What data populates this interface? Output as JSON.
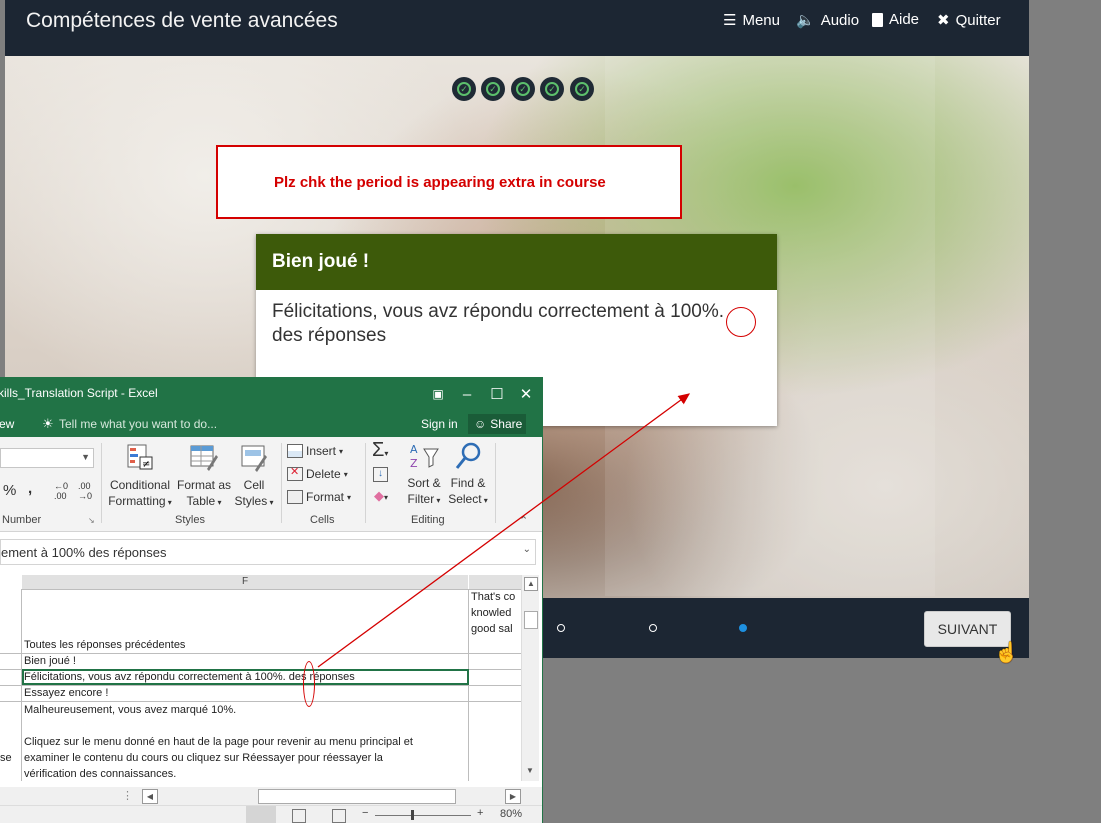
{
  "course": {
    "title": "Compétences de vente avancées",
    "nav": [
      {
        "label": "Menu",
        "icon": "list-icon"
      },
      {
        "label": "Audio",
        "icon": "speaker-icon"
      },
      {
        "label": "Aide",
        "icon": "book-icon"
      },
      {
        "label": "Quitter",
        "icon": "close-icon"
      }
    ],
    "progress_checks": 5,
    "annotation": "Plz chk the period is appearing extra in course",
    "feedback": {
      "title": "Bien joué !",
      "body": "Félicitations, vous avz répondu correctement à 100%. des réponses"
    },
    "slide_dots": 3,
    "next_button": "SUIVANT",
    "colors": {
      "topbar": "#1c2633",
      "feedback_header": "#3d5a0a",
      "annotation": "#d40000",
      "active_dot": "#1e90e0"
    }
  },
  "excel": {
    "title": "kills_Translation Script - Excel",
    "tell_me": "Tell me what you want to do...",
    "view_tab": "ew",
    "sign_in": "Sign in",
    "share": "Share",
    "ribbon": {
      "number_group": "Number",
      "percent": "%",
      "comma": ",",
      "inc_decimal": "←0\n.00",
      "dec_decimal": ".00\n→0",
      "styles_group": "Styles",
      "conditional_formatting": [
        "Conditional",
        "Formatting"
      ],
      "format_as_table": [
        "Format as",
        "Table"
      ],
      "cell_styles": [
        "Cell",
        "Styles"
      ],
      "cells_group": "Cells",
      "insert": "Insert",
      "delete": "Delete",
      "format": "Format",
      "editing_group": "Editing",
      "sort_filter": [
        "Sort &",
        "Filter"
      ],
      "find_select": [
        "Find &",
        "Select"
      ]
    },
    "formula_bar": "ement à 100% des réponses",
    "column_header": "F",
    "cells": [
      "Toutes les réponses précédentes",
      "Bien joué !",
      "Félicitations, vous avz répondu correctement à 100%. des réponses",
      "Essayez encore !",
      "Malheureusement, vous avez marqué 10%.",
      "Cliquez sur le menu donné en haut de la page pour revenir au menu principal et",
      "examiner le contenu du cours ou cliquez sur Réessayer pour réessayer la",
      "vérification des connaissances."
    ],
    "right_column": [
      "That's co",
      "knowled",
      "good sal"
    ],
    "left_fragment": "se",
    "zoom": "80%"
  }
}
